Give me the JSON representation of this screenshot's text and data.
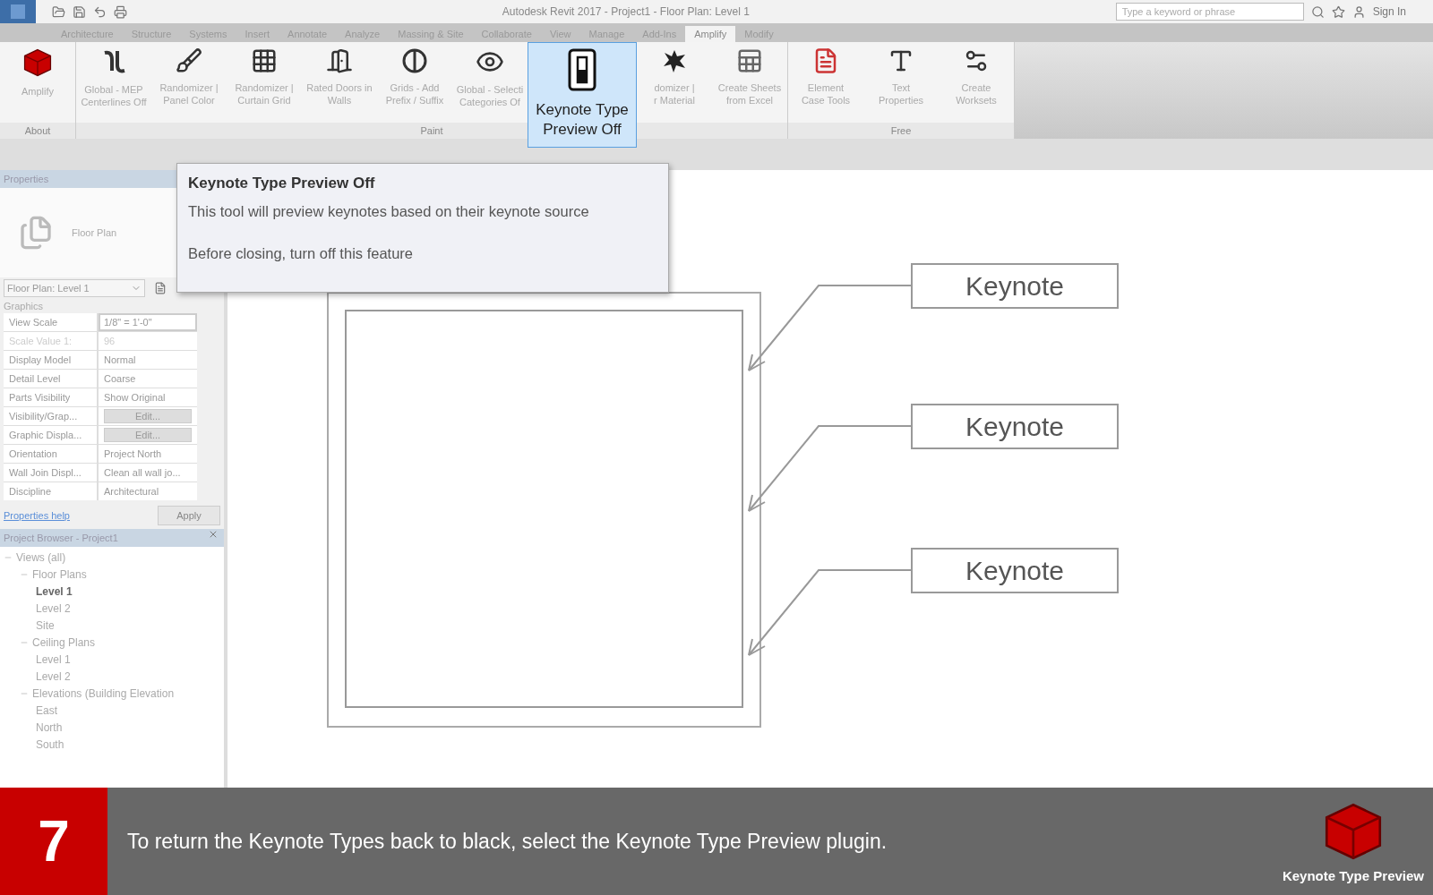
{
  "title_bar": {
    "title": "Autodesk Revit 2017 -    Project1 - Floor Plan: Level 1",
    "search": {
      "placeholder": "Type a keyword or phrase"
    },
    "sign_in": "Sign In"
  },
  "tabs": [
    {
      "label": "Architecture",
      "selected": false
    },
    {
      "label": "Structure",
      "selected": false
    },
    {
      "label": "Systems",
      "selected": false
    },
    {
      "label": "Insert",
      "selected": false
    },
    {
      "label": "Annotate",
      "selected": false
    },
    {
      "label": "Analyze",
      "selected": false
    },
    {
      "label": "Massing & Site",
      "selected": false
    },
    {
      "label": "Collaborate",
      "selected": false
    },
    {
      "label": "View",
      "selected": false
    },
    {
      "label": "Manage",
      "selected": false
    },
    {
      "label": "Add-Ins",
      "selected": false
    },
    {
      "label": "Amplify",
      "selected": true
    },
    {
      "label": "Modify",
      "selected": false
    }
  ],
  "ribbon": [
    {
      "label": "About",
      "buttons": [
        {
          "kind": "cube",
          "lines": [
            "Amplify"
          ],
          "selected": false
        }
      ]
    },
    {
      "label": "Paint",
      "buttons": [
        {
          "kind": "pipe",
          "lines": [
            "Global - MEP",
            "Centerlines Off"
          ],
          "selected": false
        },
        {
          "kind": "brush",
          "lines": [
            "Randomizer |",
            "Panel Color"
          ],
          "selected": false
        },
        {
          "kind": "grid",
          "lines": [
            "Randomizer |",
            "Curtain Grid"
          ],
          "selected": false
        },
        {
          "kind": "door",
          "lines": [
            "Rated Doors in",
            "Walls"
          ],
          "selected": false
        },
        {
          "kind": "grids",
          "lines": [
            "Grids - Add",
            "Prefix / Suffix"
          ],
          "selected": false
        },
        {
          "kind": "eye",
          "lines": [
            "Global - Selecti",
            "Categories Of"
          ],
          "selected": false
        },
        {
          "kind": "switch",
          "lines": [
            "Keynote Type",
            "Preview Off"
          ],
          "selected": true
        },
        {
          "kind": "splat",
          "lines": [
            "domizer |",
            "r Material"
          ],
          "selected": false
        },
        {
          "kind": "sheets",
          "lines": [
            "Create Sheets",
            "from Excel"
          ],
          "selected": false
        }
      ]
    },
    {
      "label": "Free",
      "buttons": [
        {
          "kind": "element",
          "lines": [
            "Element",
            "Case Tools"
          ],
          "selected": false
        },
        {
          "kind": "text",
          "lines": [
            "Text",
            "Properties"
          ],
          "selected": false
        },
        {
          "kind": "worksets",
          "lines": [
            "Create",
            "Worksets"
          ],
          "selected": false
        }
      ]
    }
  ],
  "properties": {
    "title": "Properties",
    "type_name": "Floor Plan",
    "view_selector": "Floor Plan: Level 1",
    "section": "Graphics",
    "rows": [
      {
        "name": "View Scale",
        "value": "1/8\" = 1'-0\"",
        "kind": "field",
        "disabled": false
      },
      {
        "name": "Scale Value    1:",
        "value": "96",
        "kind": "text",
        "disabled": true
      },
      {
        "name": "Display Model",
        "value": "Normal",
        "kind": "text",
        "disabled": false
      },
      {
        "name": "Detail Level",
        "value": "Coarse",
        "kind": "text",
        "disabled": false
      },
      {
        "name": "Parts Visibility",
        "value": "Show Original",
        "kind": "text",
        "disabled": false
      },
      {
        "name": "Visibility/Grap...",
        "value": "Edit...",
        "kind": "button",
        "disabled": false
      },
      {
        "name": "Graphic Displa...",
        "value": "Edit...",
        "kind": "button",
        "disabled": false
      },
      {
        "name": "Orientation",
        "value": "Project North",
        "kind": "text",
        "disabled": false
      },
      {
        "name": "Wall Join Displ...",
        "value": "Clean all wall jo...",
        "kind": "text",
        "disabled": false
      },
      {
        "name": "Discipline",
        "value": "Architectural",
        "kind": "text",
        "disabled": false
      }
    ],
    "help_link": "Properties help",
    "apply_button": "Apply"
  },
  "project_browser": {
    "title": "Project Browser - Project1",
    "tree": [
      {
        "label": "Views (all)",
        "expanded": true,
        "selected": false,
        "children": [
          {
            "label": "Floor Plans",
            "expanded": true,
            "selected": false,
            "children": [
              {
                "label": "Level 1",
                "selected": true
              },
              {
                "label": "Level 2",
                "selected": false
              },
              {
                "label": "Site",
                "selected": false
              }
            ]
          },
          {
            "label": "Ceiling Plans",
            "expanded": true,
            "selected": false,
            "children": [
              {
                "label": "Level 1",
                "selected": false
              },
              {
                "label": "Level 2",
                "selected": false
              }
            ]
          },
          {
            "label": "Elevations (Building Elevation",
            "expanded": true,
            "selected": false,
            "children": [
              {
                "label": "East",
                "selected": false
              },
              {
                "label": "North",
                "selected": false
              },
              {
                "label": "South",
                "selected": false
              }
            ]
          }
        ]
      }
    ]
  },
  "tooltip": {
    "title": "Keynote Type Preview Off",
    "lines": [
      "This tool will preview keynotes based on their keynote source",
      "Before closing, turn off this feature"
    ]
  },
  "keynotes": [
    "Keynote",
    "Keynote",
    "Keynote"
  ],
  "banner": {
    "step": "7",
    "text": "To return the Keynote Types back to black, select the Keynote Type Preview plugin.",
    "brand": "Keynote Type Preview"
  }
}
